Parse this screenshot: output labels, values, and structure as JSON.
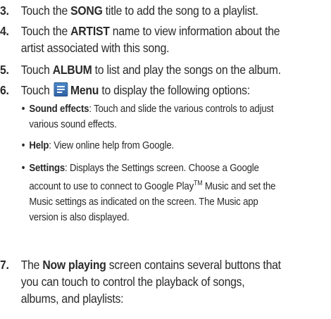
{
  "steps": [
    {
      "number": "3.",
      "lines": [
        {
          "pre": "Touch the ",
          "bold": "SONG",
          "post": " title to add the song to a playlist."
        }
      ]
    },
    {
      "number": "4.",
      "lines": [
        {
          "pre": "Touch the ",
          "bold": "ARTIST",
          "post": " name to view information about the"
        },
        {
          "text": "artist associated with this song."
        }
      ]
    },
    {
      "number": "5.",
      "lines": [
        {
          "pre": "Touch ",
          "bold": "ALBUM",
          "post": " to list and play the songs on the album."
        }
      ]
    },
    {
      "number": "6.",
      "lines": [
        {
          "pre": "Touch ",
          "icon": "menu-icon",
          "bold": "Menu",
          "post": " to display the following options:"
        }
      ],
      "bullets": [
        {
          "term": "Sound effects",
          "lines": [
            ": Touch and slide the various controls to adjust",
            "various sound effects."
          ]
        },
        {
          "term": "Help",
          "lines": [
            ": View online help from Google."
          ]
        },
        {
          "term": "Settings",
          "lines": [
            ": Displays the Settings screen. Choose a Google",
            "account to use to connect to Google Play",
            "Music and set the",
            "Music settings as indicated on the screen. The Music app",
            "version is also displayed."
          ],
          "trademark": "TM"
        }
      ]
    },
    {
      "number": "7.",
      "lines": [
        {
          "pre": "The ",
          "bold": "Now playing",
          "post": " screen contains several buttons that"
        },
        {
          "text": "you can touch to control the playback of songs,"
        },
        {
          "text": "albums, and playlists:"
        }
      ]
    }
  ]
}
